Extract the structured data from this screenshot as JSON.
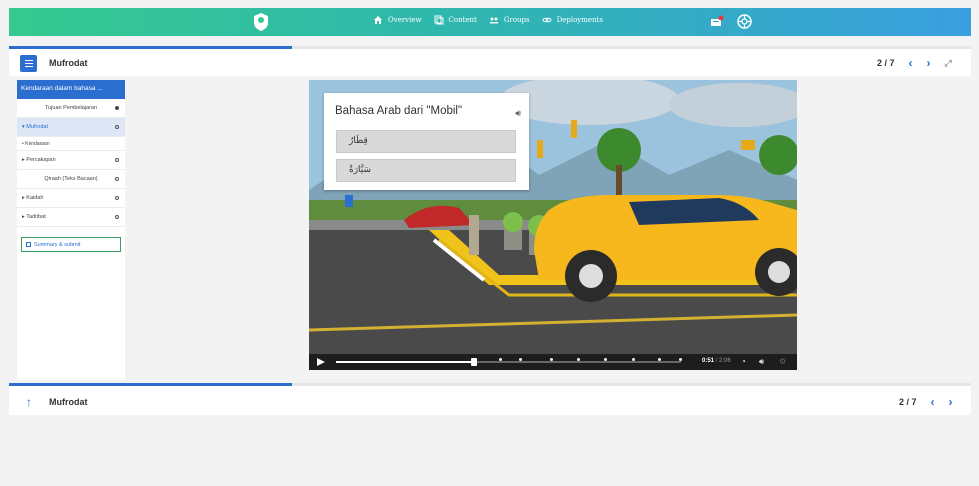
{
  "nav": {
    "items": [
      {
        "label": "Overview",
        "icon": "home-icon"
      },
      {
        "label": "Content",
        "icon": "copy-icon"
      },
      {
        "label": "Groups",
        "icon": "groups-icon"
      },
      {
        "label": "Deployments",
        "icon": "link-icon"
      }
    ]
  },
  "header": {
    "title": "Mufrodat",
    "page": "2 / 7"
  },
  "sidebar": {
    "active_heading": "Kendaraan dalam bahasa ...",
    "items": [
      {
        "label": "Tujuan Pembelajaran",
        "status": "filled"
      },
      {
        "label": "▾ Mufrodat",
        "status": "empty"
      },
      {
        "label": "• Kendaraan",
        "status": "none"
      },
      {
        "label": "▸ Percakapan",
        "status": "empty"
      },
      {
        "label": "Qiraah (Teks Bacaan)",
        "status": "empty"
      },
      {
        "label": "▸ Kaidah",
        "status": "empty"
      },
      {
        "label": "▸ Tadribat",
        "status": "empty"
      }
    ],
    "submit_label": "Summary & submit"
  },
  "video": {
    "card_title": "Bahasa Arab dari \"Mobil\"",
    "options": [
      "قِطَارٌ",
      "سَيَّارَةٌ"
    ],
    "progress": 0.4,
    "time_current": "0:51",
    "time_total": "/ 2:06"
  },
  "footer": {
    "title": "Mufrodat",
    "page": "2 / 7"
  },
  "colors": {
    "accent": "#2a6fd0",
    "topbar_start": "#35c98f",
    "topbar_end": "#3a9fe0"
  }
}
